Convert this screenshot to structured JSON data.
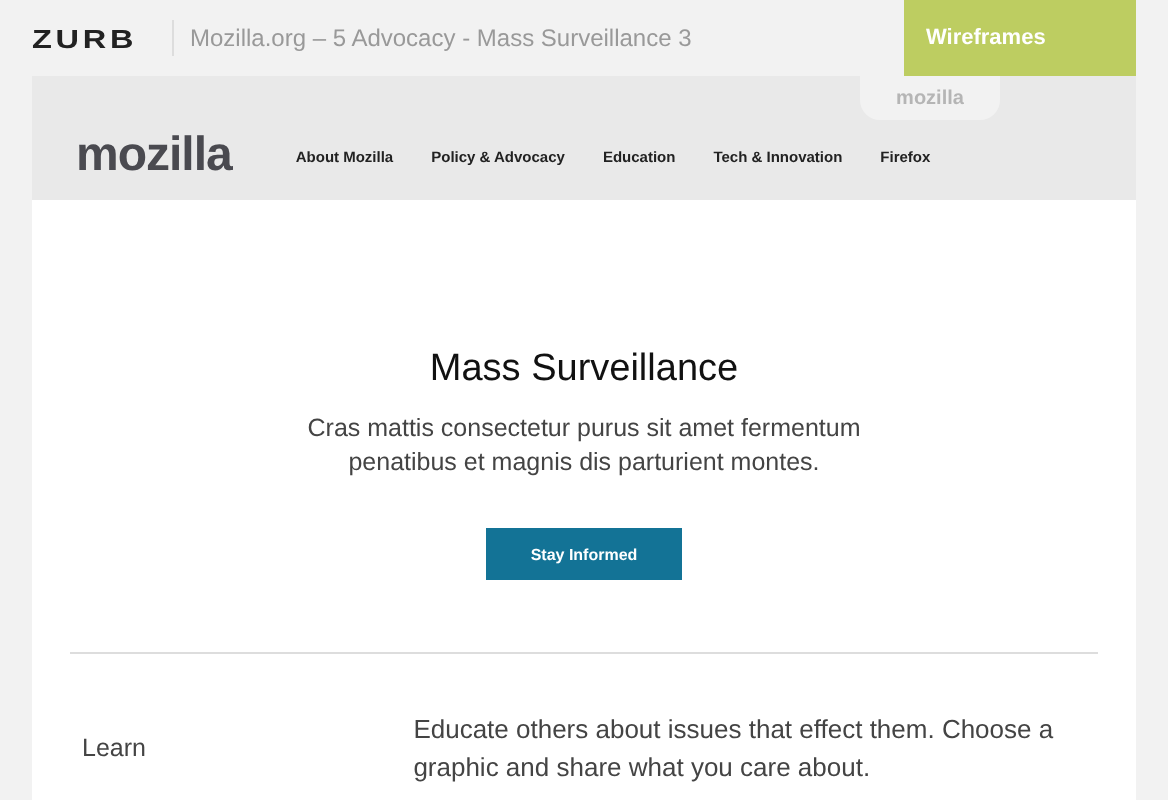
{
  "header": {
    "logo": "ZURB",
    "title": "Mozilla.org – 5 Advocacy - Mass Surveillance 3",
    "badge": "Wireframes"
  },
  "site": {
    "tab": "mozilla",
    "logo": "mozilla",
    "nav": [
      {
        "label": "About Mozilla"
      },
      {
        "label": "Policy & Advocacy"
      },
      {
        "label": "Education"
      },
      {
        "label": "Tech & Innovation"
      },
      {
        "label": "Firefox"
      }
    ]
  },
  "hero": {
    "title": "Mass Surveillance",
    "text": "Cras mattis consectetur purus sit amet fermentum penatibus et magnis dis parturient montes.",
    "button": "Stay Informed"
  },
  "section": {
    "label": "Learn",
    "text": "Educate others about issues that effect them. Choose a graphic and share what you care about."
  }
}
